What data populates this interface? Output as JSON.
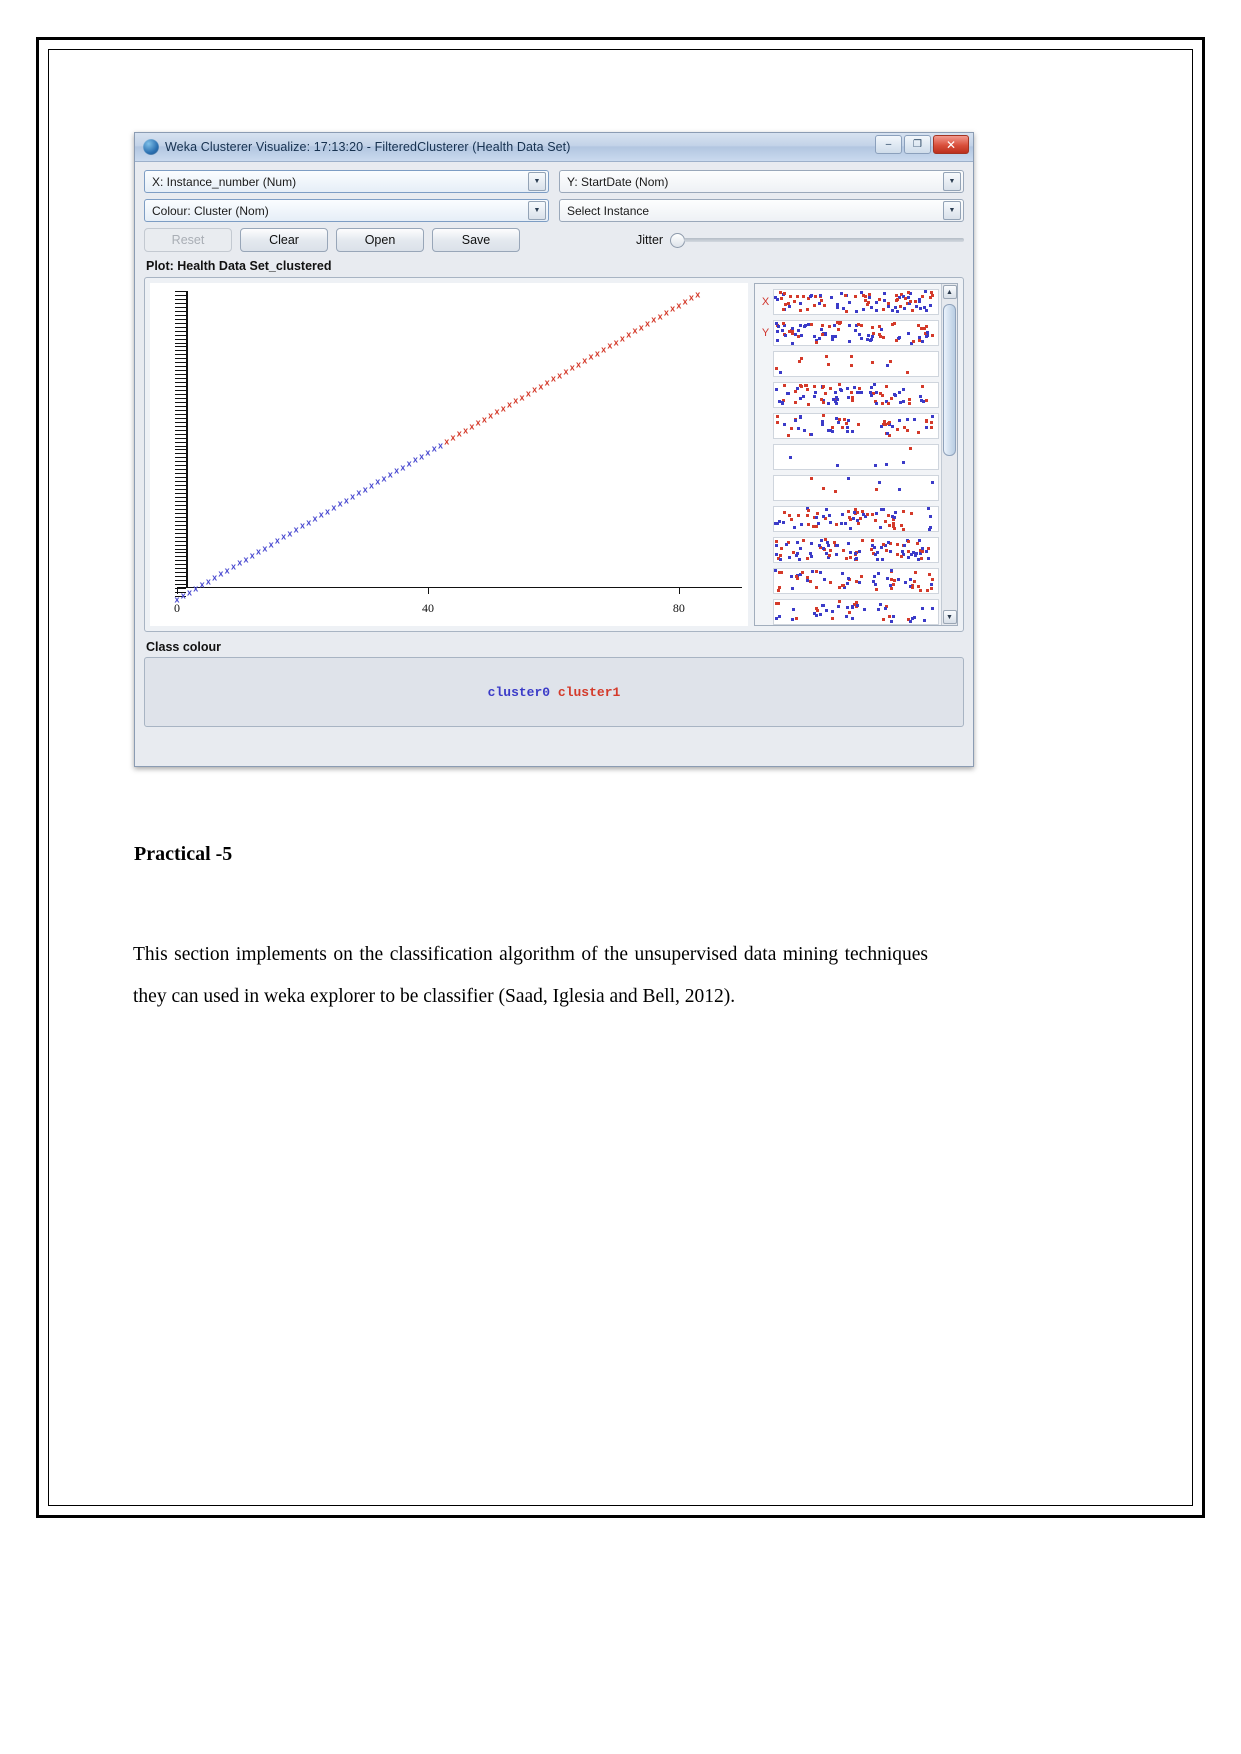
{
  "window": {
    "title": "Weka Clusterer Visualize: 17:13:20 - FilteredClusterer (Health Data Set)",
    "icon": "weka-bird-icon",
    "buttons": {
      "minimize": "–",
      "maximize": "❐",
      "close": "✕"
    }
  },
  "selectors": {
    "x_axis": "X: Instance_number (Num)",
    "y_axis": "Y: StartDate (Nom)",
    "colour": "Colour: Cluster (Nom)",
    "instance": "Select Instance",
    "arrow_glyph": "▼"
  },
  "toolbar": {
    "reset": "Reset",
    "clear": "Clear",
    "open": "Open",
    "save": "Save",
    "jitter": "Jitter"
  },
  "plot": {
    "title": "Plot: Health Data Set_clustered",
    "class_colour_label": "Class colour",
    "legend": {
      "cluster0": "cluster0",
      "cluster1": "cluster1",
      "cluster0_color": "#3b3bc8",
      "cluster1_color": "#d43a2a"
    }
  },
  "attributes": {
    "x_key": "X",
    "y_key": "Y",
    "key_color": "#d0342c",
    "scroll_up": "▲",
    "scroll_down": "▼"
  },
  "document": {
    "heading": "Practical -5",
    "paragraph": "This section implements on the classification algorithm of the unsupervised data mining techniques they can used in weka explorer to be classifier (Saad, Iglesia and Bell, 2012)."
  },
  "chart_data": {
    "type": "scatter",
    "title": "Plot: Health Data Set_clustered",
    "xlabel": "Instance_number (Num)",
    "ylabel": "StartDate (Nom)",
    "xlim": [
      0,
      84
    ],
    "ylim": [
      0,
      84
    ],
    "xticks": [
      0,
      40,
      80
    ],
    "xtick_labels": [
      "0",
      "40",
      "80"
    ],
    "grid": false,
    "marker": "x",
    "legend": [
      "cluster0",
      "cluster1"
    ],
    "legend_position": "bottom-center",
    "series": [
      {
        "name": "cluster0",
        "color": "#4a4ad0",
        "x": [
          0,
          1,
          2,
          3,
          4,
          5,
          6,
          7,
          8,
          9,
          10,
          11,
          12,
          13,
          14,
          15,
          16,
          17,
          18,
          19,
          20,
          21,
          22,
          23,
          24,
          25,
          26,
          27,
          28,
          29,
          30,
          31,
          32,
          33,
          34,
          35,
          36,
          37,
          38,
          39,
          40,
          41,
          42
        ],
        "y": [
          0,
          1,
          2,
          3,
          4,
          5,
          6,
          7,
          8,
          9,
          10,
          11,
          12,
          13,
          14,
          15,
          16,
          17,
          18,
          19,
          20,
          21,
          22,
          23,
          24,
          25,
          26,
          27,
          28,
          29,
          30,
          31,
          32,
          33,
          34,
          35,
          36,
          37,
          38,
          39,
          40,
          41,
          42
        ]
      },
      {
        "name": "cluster1",
        "color": "#d43a2a",
        "x": [
          43,
          44,
          45,
          46,
          47,
          48,
          49,
          50,
          51,
          52,
          53,
          54,
          55,
          56,
          57,
          58,
          59,
          60,
          61,
          62,
          63,
          64,
          65,
          66,
          67,
          68,
          69,
          70,
          71,
          72,
          73,
          74,
          75,
          76,
          77,
          78,
          79,
          80,
          81,
          82,
          83
        ],
        "y": [
          43,
          44,
          45,
          46,
          47,
          48,
          49,
          50,
          51,
          52,
          53,
          54,
          55,
          56,
          57,
          58,
          59,
          60,
          61,
          62,
          63,
          64,
          65,
          66,
          67,
          68,
          69,
          70,
          71,
          72,
          73,
          74,
          75,
          76,
          77,
          78,
          79,
          80,
          81,
          82,
          83
        ]
      }
    ]
  }
}
